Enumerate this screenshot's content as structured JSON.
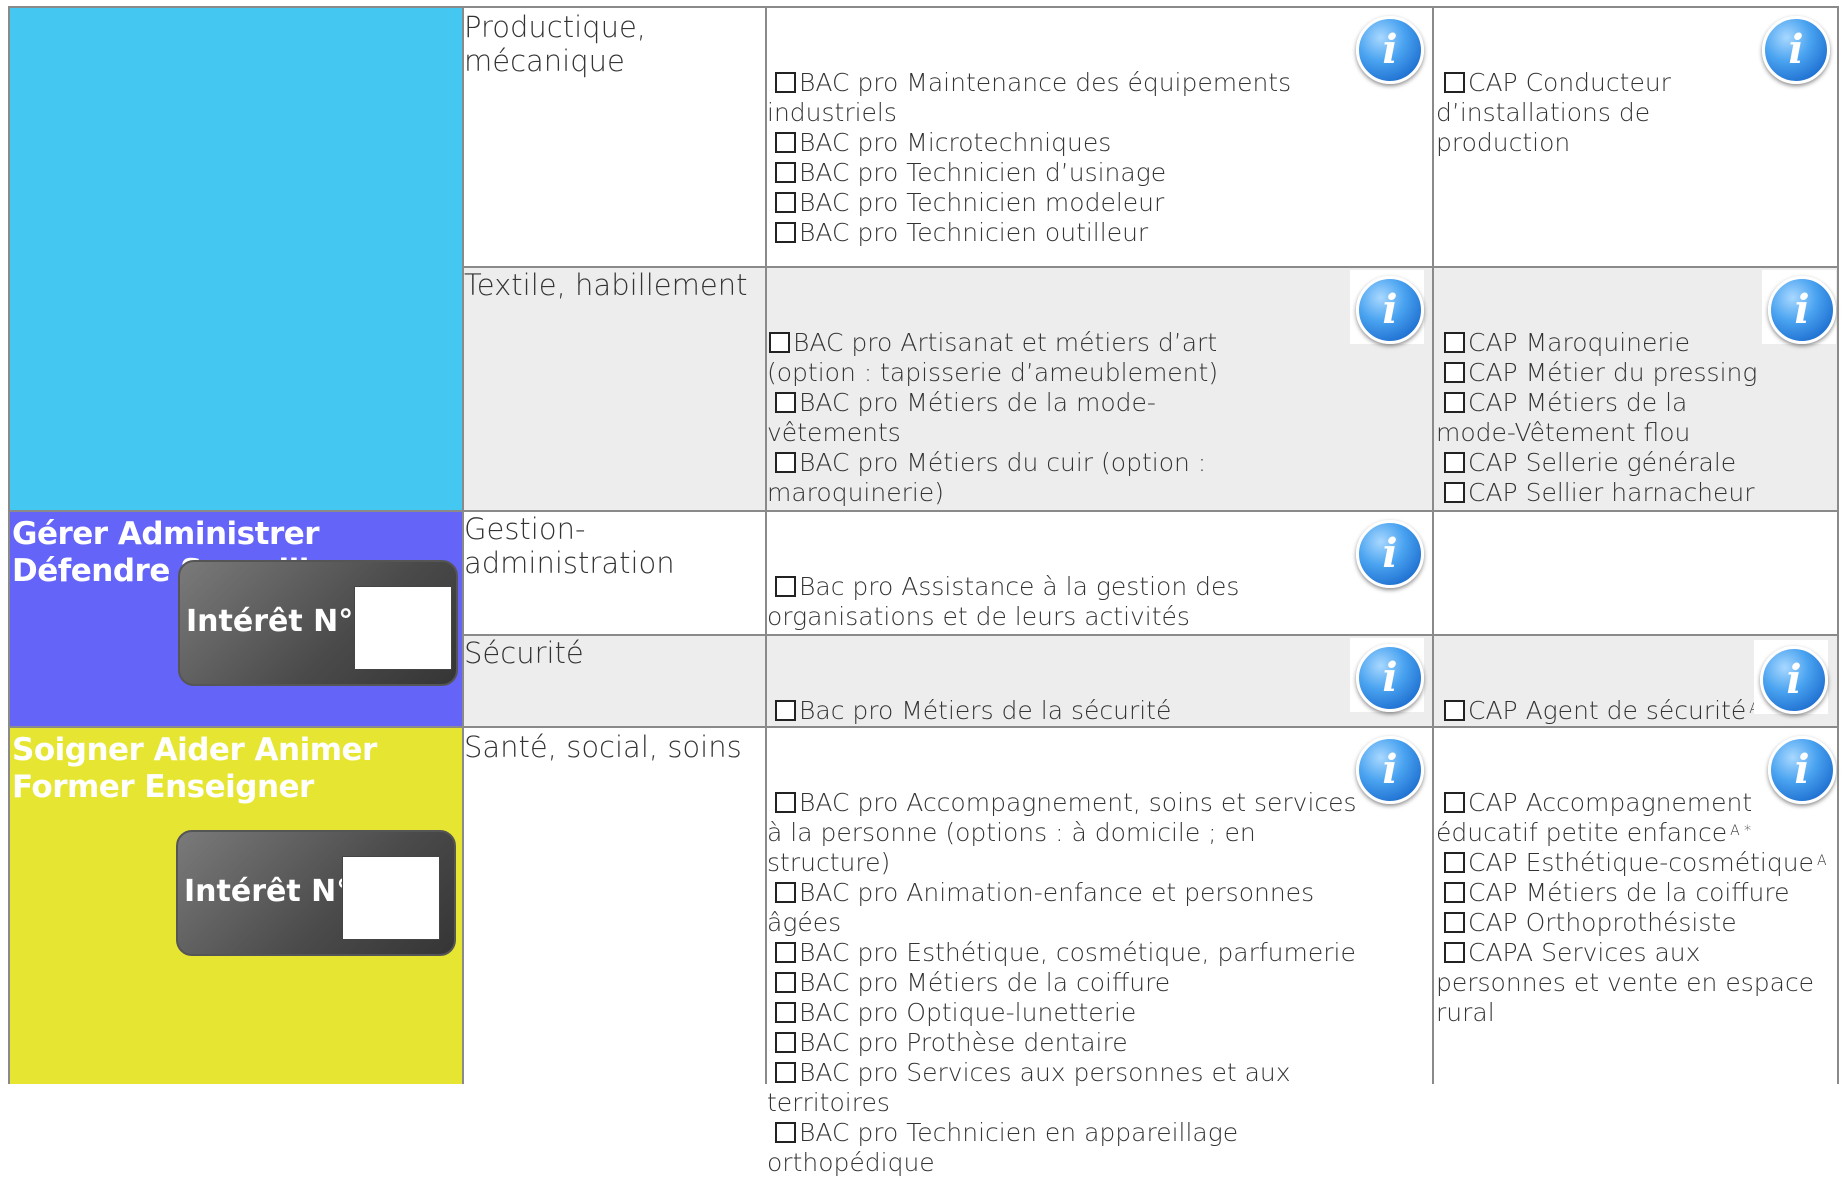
{
  "categories": [
    {
      "title": "",
      "color": "#44c8f2"
    },
    {
      "title": "Gérer Administrer Défendre Surveiller",
      "color": "#6464f8",
      "interest_label": "Intérêt N°"
    },
    {
      "title": "Soigner Aider Animer Former Enseigner",
      "color": "#e6e632",
      "interest_label": "Intérêt N°"
    }
  ],
  "rows": [
    {
      "sector": "Productique, mécanique",
      "bac": [
        "BAC pro Maintenance des équipements industriels",
        "BAC pro Microtechniques",
        "BAC pro Technicien d’usinage",
        "BAC pro Technicien modeleur",
        "BAC pro Technicien outilleur"
      ],
      "cap": [
        "CAP Conducteur d’installations de production"
      ]
    },
    {
      "sector": "Textile, habillement",
      "bac": [
        "BAC pro Artisanat et métiers d’art (option : tapisserie d’ameublement)",
        "BAC pro Métiers de la mode-vêtements",
        "BAC pro Métiers du cuir (option : maroquinerie)"
      ],
      "cap": [
        "CAP Maroquinerie",
        "CAP Métier du pressing",
        "CAP Métiers de la mode-Vêtement flou",
        "CAP Sellerie générale",
        "CAP Sellier harnacheur"
      ]
    },
    {
      "sector": "Gestion-administration",
      "bac": [
        "Bac pro Assistance à la gestion des organisations et de leurs activités"
      ],
      "cap": []
    },
    {
      "sector": "Sécurité",
      "bac": [
        "Bac pro Métiers de la sécurité"
      ],
      "cap": [
        "CAP Agent de sécurité"
      ],
      "cap_sup": [
        "A"
      ]
    },
    {
      "sector": "Santé, social, soins",
      "bac": [
        "BAC pro Accompagnement, soins et services à la personne (options : à domicile ; en structure)",
        "BAC pro Animation-enfance et personnes âgées",
        "BAC pro Esthétique, cosmétique, parfumerie",
        "BAC pro Métiers de la coiffure",
        "BAC pro Optique-lunetterie",
        "BAC pro Prothèse dentaire",
        "BAC pro Services aux personnes et aux territoires",
        "BAC pro Technicien en appareillage orthopédique"
      ],
      "cap": [
        "CAP Accompagnement éducatif petite enfance",
        "CAP Esthétique-cosmétique",
        "CAP Métiers de la coiffure",
        "CAP Orthoprothésiste",
        "CAPA Services aux personnes et vente en espace rural"
      ],
      "cap_sup": [
        "A *",
        "A"
      ]
    }
  ],
  "icons": {
    "info": "info-icon",
    "checkbox": "checkbox-icon"
  },
  "info_glyph": "i"
}
